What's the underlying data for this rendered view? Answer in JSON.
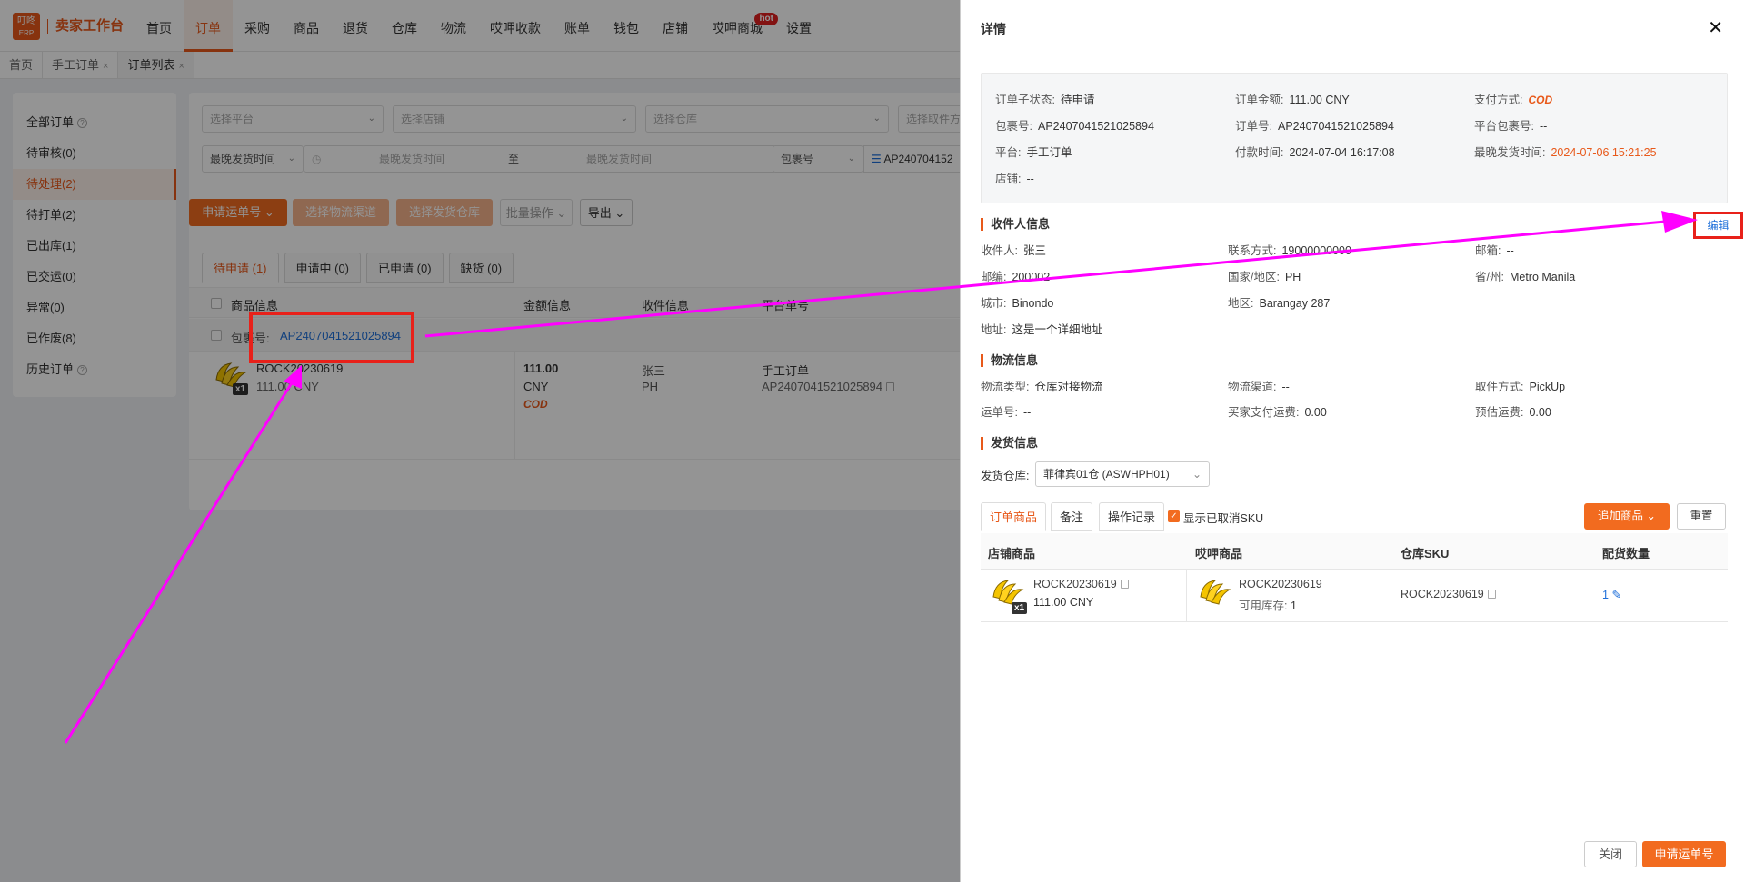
{
  "nav": {
    "logo_top": "叮咚",
    "logo_bottom": "ERP",
    "title": "卖家工作台",
    "items": [
      {
        "label": "首页"
      },
      {
        "label": "订单"
      },
      {
        "label": "采购"
      },
      {
        "label": "商品"
      },
      {
        "label": "退货"
      },
      {
        "label": "仓库"
      },
      {
        "label": "物流"
      },
      {
        "label": "哎呷收款"
      },
      {
        "label": "账单"
      },
      {
        "label": "钱包"
      },
      {
        "label": "店铺"
      },
      {
        "label": "哎呷商城",
        "badge": "hot"
      },
      {
        "label": "设置"
      }
    ],
    "active_index": 1
  },
  "tabs": [
    {
      "label": "首页"
    },
    {
      "label": "手工订单",
      "close": "×"
    },
    {
      "label": "订单列表",
      "close": "×"
    }
  ],
  "sidebar": {
    "items": [
      {
        "label": "全部订单",
        "help": "?"
      },
      {
        "label": "待审核(0)"
      },
      {
        "label": "待处理(2)"
      },
      {
        "label": "待打单(2)"
      },
      {
        "label": "已出库(1)"
      },
      {
        "label": "已交运(0)"
      },
      {
        "label": "异常(0)"
      },
      {
        "label": "已作废(8)"
      },
      {
        "label": "历史订单",
        "help": "?"
      }
    ],
    "active_index": 2
  },
  "filters": {
    "platform": "选择平台",
    "store": "选择店铺",
    "warehouse": "选择仓库",
    "pickup": "选择取件方",
    "latest_ship": "最晚发货时间",
    "range_start": "最晚发货时间",
    "range_sep": "至",
    "range_end": "最晚发货时间",
    "pkg_type": "包裹号",
    "pkg_value": "AP240704152"
  },
  "actions": {
    "apply_tracking": "申请运单号",
    "select_channel": "选择物流渠道",
    "select_warehouse": "选择发货仓库",
    "batch": "批量操作",
    "export": "导出"
  },
  "subtabs": [
    {
      "label": "待申请 (1)"
    },
    {
      "label": "申请中 (0)"
    },
    {
      "label": "已申请 (0)"
    },
    {
      "label": "缺货 (0)"
    }
  ],
  "table": {
    "headers": {
      "product": "商品信息",
      "amount": "金额信息",
      "receiver": "收件信息",
      "platform_no": "平台单号"
    },
    "pkg_label": "包裹号:",
    "pkg_no": "AP2407041521025894",
    "row": {
      "sku": "ROCK20230619",
      "price": "111.00 CNY",
      "qty": "x1",
      "amount": "111.00",
      "currency": "CNY",
      "pay": "COD",
      "receiver_name": "张三",
      "receiver_country": "PH",
      "platform": "手工订单",
      "platform_no": "AP2407041521025894"
    }
  },
  "drawer": {
    "title": "详情",
    "close": "✕",
    "info": {
      "sub_status_k": "订单子状态:",
      "sub_status_v": "待申请",
      "amount_k": "订单金额:",
      "amount_v": "111.00 CNY",
      "pay_k": "支付方式:",
      "pay_v": "COD",
      "pkg_k": "包裹号:",
      "pkg_v": "AP2407041521025894",
      "order_k": "订单号:",
      "order_v": "AP2407041521025894",
      "plat_pkg_k": "平台包裹号:",
      "plat_pkg_v": "--",
      "platform_k": "平台:",
      "platform_v": "手工订单",
      "paid_k": "付款时间:",
      "paid_v": "2024-07-04 16:17:08",
      "latest_k": "最晚发货时间:",
      "latest_v": "2024-07-06 15:21:25",
      "store_k": "店铺:",
      "store_v": "--"
    },
    "receiver": {
      "title": "收件人信息",
      "edit": "编辑",
      "name_k": "收件人:",
      "name_v": "张三",
      "phone_k": "联系方式:",
      "phone_v": "19000000000",
      "mail_k": "邮箱:",
      "mail_v": "--",
      "zip_k": "邮编:",
      "zip_v": "200002",
      "country_k": "国家/地区:",
      "country_v": "PH",
      "province_k": "省/州:",
      "province_v": "Metro Manila",
      "city_k": "城市:",
      "city_v": "Binondo",
      "district_k": "地区:",
      "district_v": "Barangay 287",
      "address_k": "地址:",
      "address_v": "这是一个详细地址"
    },
    "logistics": {
      "title": "物流信息",
      "type_k": "物流类型:",
      "type_v": "仓库对接物流",
      "channel_k": "物流渠道:",
      "channel_v": "--",
      "pickup_k": "取件方式:",
      "pickup_v": "PickUp",
      "tracking_k": "运单号:",
      "tracking_v": "--",
      "buyer_fee_k": "买家支付运费:",
      "buyer_fee_v": "0.00",
      "est_fee_k": "预估运费:",
      "est_fee_v": "0.00"
    },
    "shipping": {
      "title": "发货信息",
      "wh_k": "发货仓库:",
      "wh_v": "菲律宾01仓 (ASWHPH01)"
    },
    "tabs": [
      {
        "label": "订单商品"
      },
      {
        "label": "备注"
      },
      {
        "label": "操作记录"
      }
    ],
    "show_cancelled": "显示已取消SKU",
    "add_product": "追加商品",
    "reset": "重置",
    "headers": {
      "store_prod": "店铺商品",
      "ay_prod": "哎呷商品",
      "wh_sku": "仓库SKU",
      "qty": "配货数量"
    },
    "row": {
      "store_sku": "ROCK20230619",
      "store_price": "111.00 CNY",
      "qty_badge": "x1",
      "ay_sku": "ROCK20230619",
      "stock_k": "可用库存:",
      "stock_v": "1",
      "wh_sku": "ROCK20230619",
      "qty": "1"
    },
    "footer": {
      "close": "关闭",
      "apply": "申请运单号"
    }
  },
  "colors": {
    "accent": "#e8591a",
    "annotation": "#e8211a",
    "arrow": "#ff00ff"
  }
}
